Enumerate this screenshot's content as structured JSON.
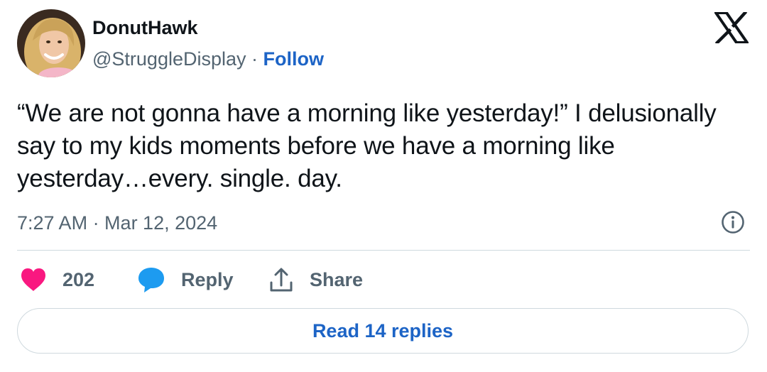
{
  "author": {
    "display_name": "DonutHawk",
    "handle": "@StruggleDisplay",
    "separator": " · ",
    "follow_label": "Follow",
    "avatar_icon": "profile-photo"
  },
  "tweet": {
    "text": "“We are not gonna have a morning like yesterday!” I delusionally say to my kids moments before we have a morning like yesterday…every. single. day.",
    "timestamp": "7:27 AM · Mar 12, 2024"
  },
  "actions": {
    "like_count": "202",
    "reply_label": "Reply",
    "share_label": "Share"
  },
  "read_replies_label": "Read 14 replies",
  "icons": {
    "platform": "x-logo-icon",
    "info": "info-icon",
    "like": "heart-icon",
    "reply": "speech-bubble-icon",
    "share": "share-arrow-icon"
  },
  "colors": {
    "accent": "#1d64c6",
    "like": "#f91880",
    "reply": "#1d9bf0",
    "muted": "#536471",
    "text": "#0f1419",
    "border": "#cfd9de"
  }
}
